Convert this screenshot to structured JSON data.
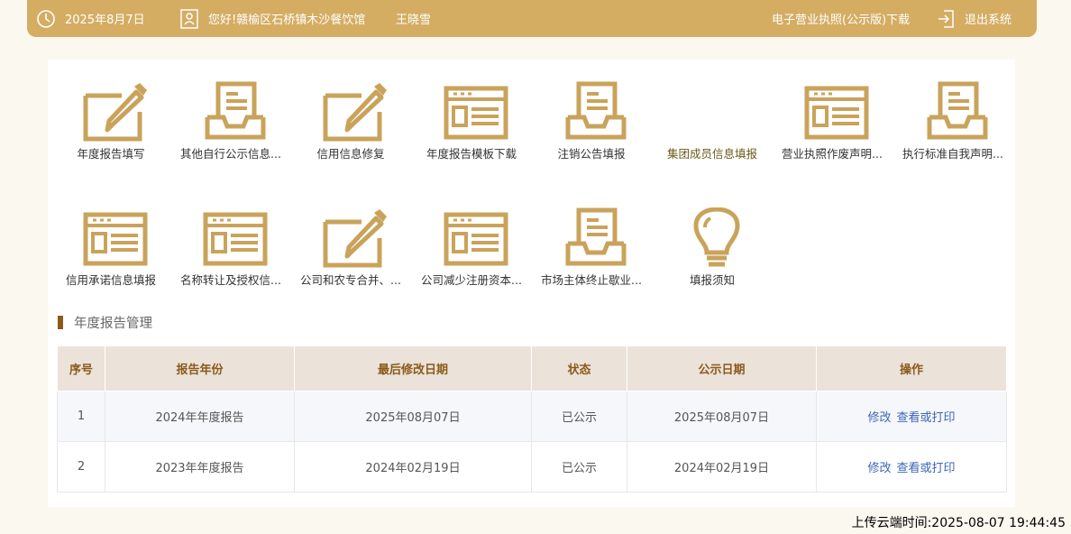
{
  "topbar": {
    "date": "2025年8月7日",
    "greeting": "您好!赣榆区石桥镇木沙餐饮馆",
    "user_name": "王晓雪",
    "license_download": "电子营业执照(公示版)下载",
    "logout": "退出系统"
  },
  "tiles_row1": [
    {
      "label": "年度报告填写",
      "icon": "pencil-icon"
    },
    {
      "label": "其他自行公示信息...",
      "icon": "inbox-tray-icon"
    },
    {
      "label": "信用信息修复",
      "icon": "pencil-icon"
    },
    {
      "label": "年度报告模板下载",
      "icon": "form-window-icon"
    },
    {
      "label": "注销公告填报",
      "icon": "inbox-tray-icon"
    },
    {
      "label": "集团成员信息填报",
      "icon": ""
    },
    {
      "label": "营业执照作废声明...",
      "icon": "form-window-icon"
    },
    {
      "label": "执行标准自我声明...",
      "icon": "inbox-tray-icon"
    }
  ],
  "tiles_row2": [
    {
      "label": "信用承诺信息填报",
      "icon": "form-window-icon"
    },
    {
      "label": "名称转让及授权信...",
      "icon": "form-window-icon"
    },
    {
      "label": "公司和农专合并、...",
      "icon": "pencil-icon"
    },
    {
      "label": "公司减少注册资本...",
      "icon": "form-window-icon"
    },
    {
      "label": "市场主体终止歇业...",
      "icon": "inbox-tray-icon"
    },
    {
      "label": "填报须知",
      "icon": "lightbulb-icon"
    }
  ],
  "section_title": "年度报告管理",
  "table": {
    "headers": [
      "序号",
      "报告年份",
      "最后修改日期",
      "状态",
      "公示日期",
      "操作"
    ],
    "rows": [
      {
        "index": "1",
        "year": "2024年年度报告",
        "modified": "2025年08月07日",
        "status": "已公示",
        "published": "2025年08月07日",
        "edit": "修改",
        "view": "查看或打印"
      },
      {
        "index": "2",
        "year": "2023年年度报告",
        "modified": "2024年02月19日",
        "status": "已公示",
        "published": "2024年02月19日",
        "edit": "修改",
        "view": "查看或打印"
      }
    ]
  },
  "upload_time": "上传云端时间:2025-08-07 19:44:45",
  "colors": {
    "topbar": "#d4ad63",
    "icon_gold": "#c9a35b",
    "header_text": "#8b5a1a",
    "link": "#3b66b8"
  }
}
